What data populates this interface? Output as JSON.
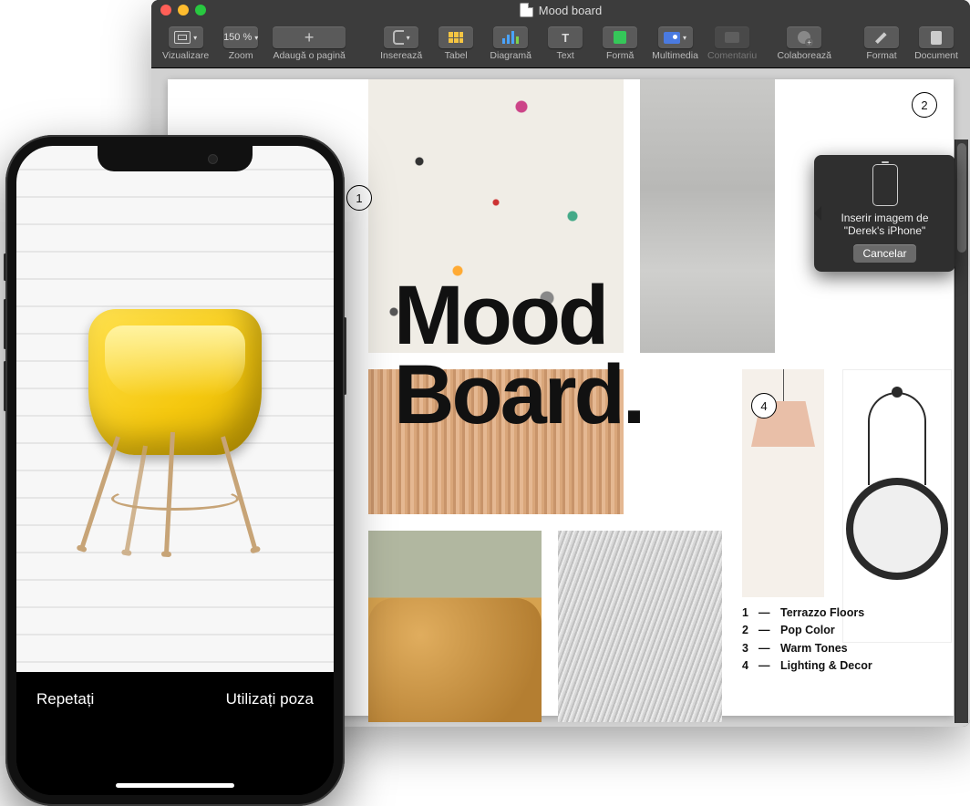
{
  "window": {
    "title": "Mood board"
  },
  "toolbar": {
    "view": "Vizualizare",
    "zoom": {
      "label": "Zoom",
      "value": "150 %"
    },
    "addPage": "Adaugă o pagină",
    "insert": "Inserează",
    "table": "Tabel",
    "chart": "Diagramă",
    "text": "Text",
    "shape": "Formă",
    "media": "Multimedia",
    "comment": "Comentariu",
    "collaborate": "Colaborează",
    "format": "Format",
    "document": "Document"
  },
  "document": {
    "title": "Mood\nBoard.",
    "badges": {
      "b1": "1",
      "b2": "2",
      "b4": "4"
    },
    "legend": [
      {
        "n": "1",
        "label": "Terrazzo Floors"
      },
      {
        "n": "2",
        "label": "Pop Color"
      },
      {
        "n": "3",
        "label": "Warm Tones"
      },
      {
        "n": "4",
        "label": "Lighting & Decor"
      }
    ]
  },
  "popover": {
    "text": "Inserir imagem de \"Derek's iPhone\"",
    "cancel": "Cancelar"
  },
  "iphone": {
    "retake": "Repetați",
    "use": "Utilizați poza"
  }
}
